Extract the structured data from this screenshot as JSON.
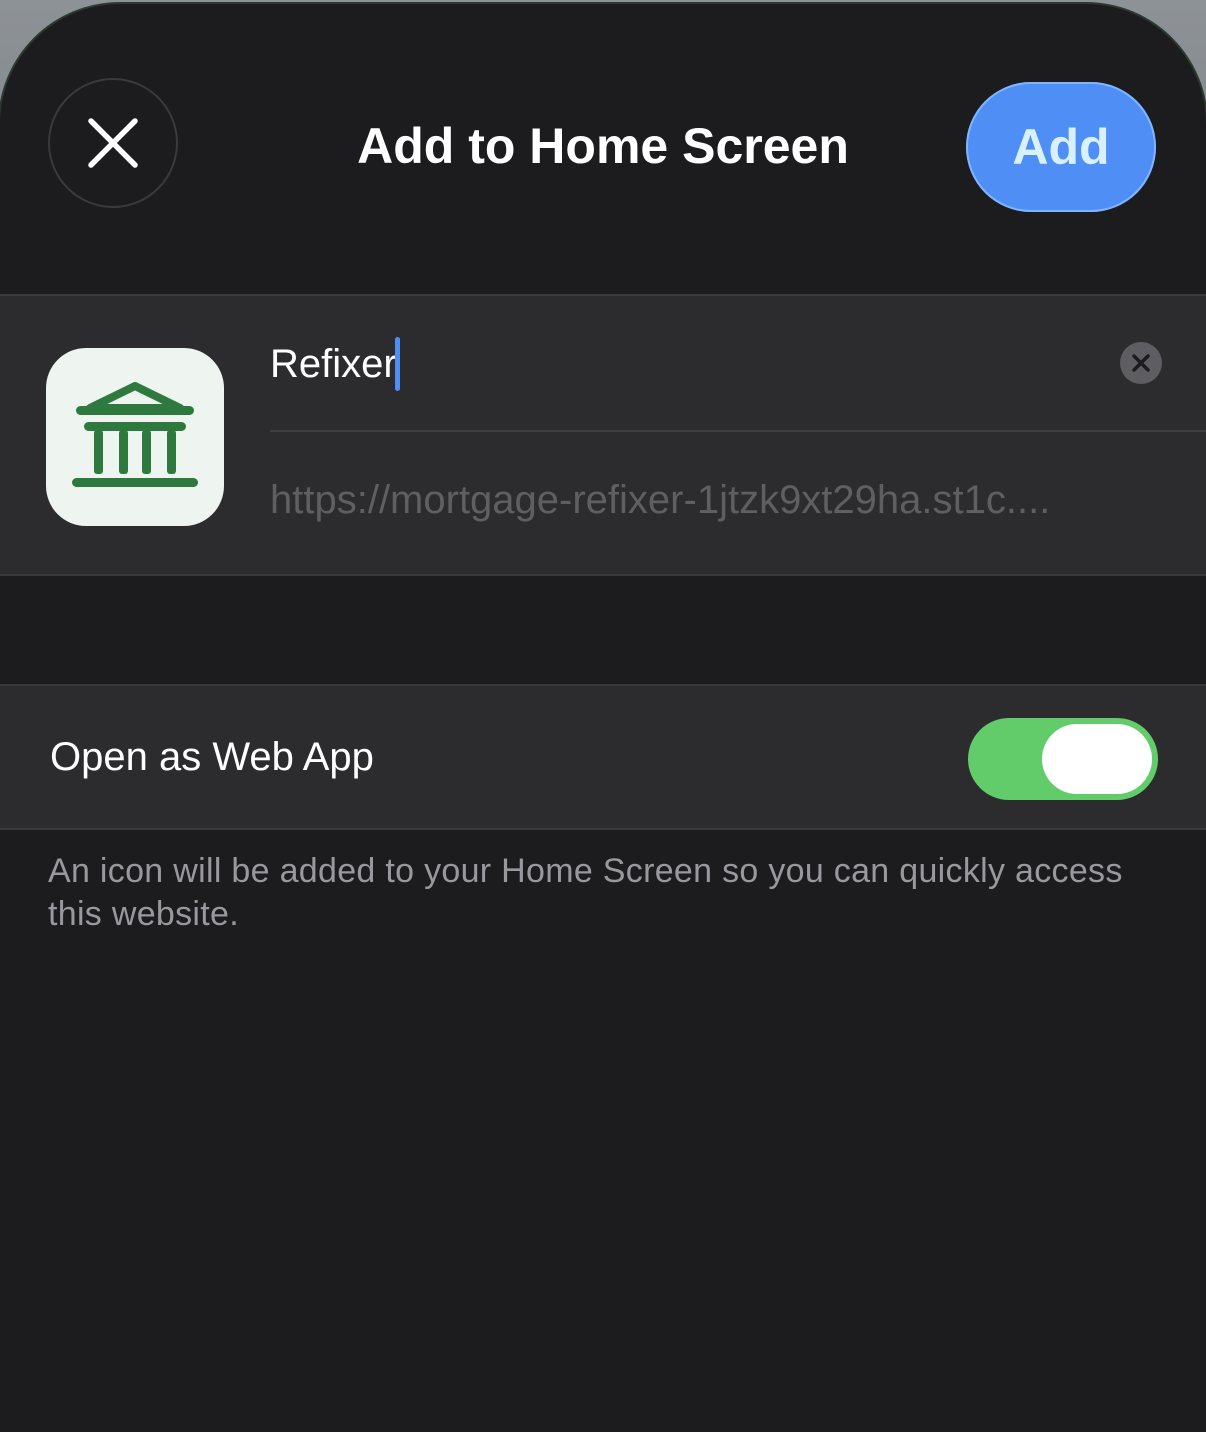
{
  "header": {
    "title": "Add to Home Screen",
    "add_label": "Add",
    "close_icon": "close-icon"
  },
  "app": {
    "icon": "bank-icon",
    "icon_color": "#2e7a3e",
    "name_value": "Refixer",
    "url": "https://mortgage-refixer-1jtzk9xt29ha.st1c....",
    "clear_icon": "clear-circle-icon"
  },
  "settings": {
    "web_app_label": "Open as Web App",
    "web_app_enabled": true,
    "footnote": "An icon will be added to your Home Screen so you can quickly access this website."
  },
  "colors": {
    "accent": "#4f8ef5",
    "toggle_on": "#63cc6a",
    "background": "#1c1c1e",
    "group": "#2c2c2e"
  }
}
